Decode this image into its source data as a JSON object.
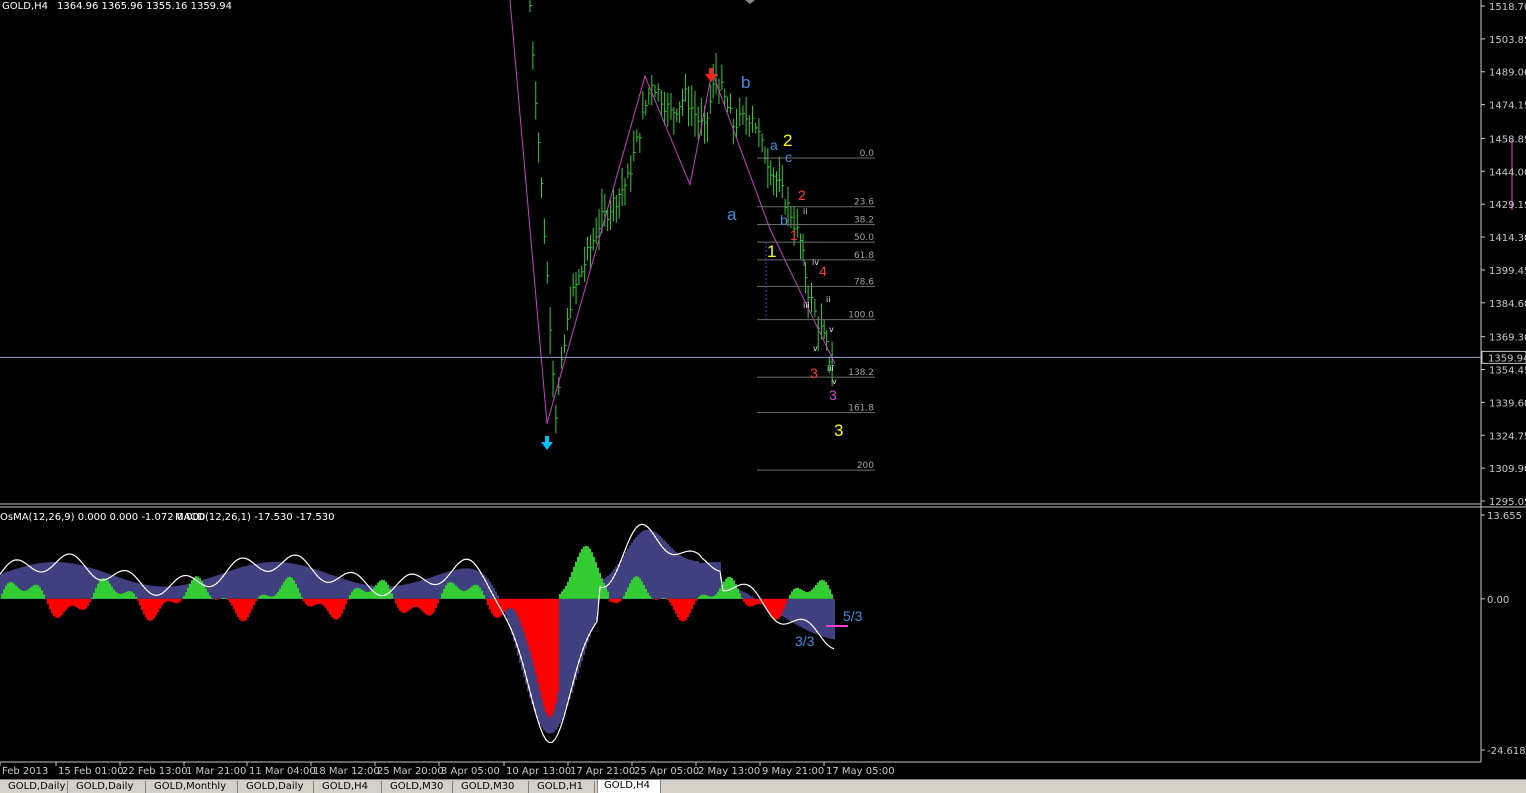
{
  "header": {
    "main_label": "GOLD,H4",
    "main_values": "1364.96 1365.96 1355.16 1359.94",
    "indicator_label": "OsMA(12,26,9) 0.000 0.000 -1.072 0.000",
    "macd_label": "MACD(12,26,1) -17.530 -17.530"
  },
  "chart_data": [
    {
      "type": "bar",
      "symbol": "GOLD",
      "timeframe": "H4",
      "ylim": [
        1295.05,
        1518.7
      ],
      "price_ticks": [
        "1518.70",
        "1503.85",
        "1489.00",
        "1474.15",
        "1458.85",
        "1444.00",
        "1429.15",
        "1414.30",
        "1399.45",
        "1384.60",
        "1369.30",
        "1354.45",
        "1339.60",
        "1324.75",
        "1309.90",
        "1295.05"
      ],
      "current_price": "1359.94",
      "x_ticks": [
        "Feb 2013",
        "15 Feb 01:00",
        "22 Feb 13:00",
        "1 Mar 21:00",
        "11 Mar 04:00",
        "18 Mar 12:00",
        "25 Mar 20:00",
        "3 Apr 05:00",
        "10 Apr 13:00",
        "17 Apr 21:00",
        "25 Apr 05:00",
        "2 May 13:00",
        "9 May 21:00",
        "17 May 05:00"
      ],
      "price_path": [
        [
          1518,
          1519
        ],
        [
          1545,
          1335
        ],
        [
          1560,
          1385
        ],
        [
          1590,
          1420
        ],
        [
          1620,
          1440
        ],
        [
          1645,
          1485
        ],
        [
          1665,
          1470
        ],
        [
          1680,
          1478
        ],
        [
          1700,
          1462
        ],
        [
          1712,
          1488
        ],
        [
          1730,
          1465
        ],
        [
          1750,
          1470
        ],
        [
          1760,
          1455
        ],
        [
          1775,
          1440
        ],
        [
          1790,
          1425
        ],
        [
          1800,
          1412
        ],
        [
          1808,
          1390
        ],
        [
          1815,
          1380
        ],
        [
          1822,
          1372
        ],
        [
          1830,
          1360
        ],
        [
          1836,
          1355
        ]
      ],
      "fib_levels": [
        "0.0",
        "23.6",
        "38.2",
        "50.0",
        "61.8",
        "78.6",
        "100.0",
        "138.2",
        "161.8",
        "200"
      ],
      "fib_prices": [
        1450,
        1428,
        1420,
        1412,
        1404,
        1392,
        1377,
        1351,
        1335,
        1309
      ],
      "wave_labels": [
        {
          "text": "b",
          "color": "#3d8fe0"
        },
        {
          "text": "2",
          "color": "#ffff00"
        },
        {
          "text": "a",
          "color": "#3d8fe0"
        },
        {
          "text": "c",
          "color": "#3d8fe0"
        },
        {
          "text": "a",
          "color": "#3d8fe0"
        },
        {
          "text": "b",
          "color": "#3d8fe0"
        },
        {
          "text": "2",
          "color": "#ff3b2f"
        },
        {
          "text": "1",
          "color": "#ff3b2f"
        },
        {
          "text": "1",
          "color": "#ffff00"
        },
        {
          "text": "4",
          "color": "#ff3b2f"
        },
        {
          "text": "3",
          "color": "#ff3b2f"
        },
        {
          "text": "3",
          "color": "#ffff00"
        },
        {
          "text": "3",
          "color": "#d24bd2"
        }
      ],
      "roman_labels": [
        "ii",
        "i",
        "iv",
        "iii",
        "ii",
        "v",
        "iii",
        "v",
        "v"
      ]
    },
    {
      "type": "bar",
      "indicator": "OsMA / MACD",
      "ylim": [
        -24.618,
        13.655
      ],
      "y_ticks": [
        "13.655",
        "0.00",
        "-24.618"
      ],
      "annotations": [
        {
          "text": "5/3",
          "color": "#3d8fe0"
        },
        {
          "text": "3/3",
          "color": "#3d8fe0"
        }
      ],
      "colors": {
        "positive": "#33cc33",
        "negative": "#ff0000",
        "macd_fill": "#8080ff",
        "signal": "#ffffff"
      }
    }
  ],
  "tabs": [
    "GOLD,Daily",
    "GOLD,Daily",
    "GOLD,Monthly",
    "GOLD,Daily",
    "GOLD,H4",
    "GOLD,M30",
    "GOLD,M30",
    "GOLD,H1",
    "GOLD,H4"
  ],
  "active_tab": 8
}
